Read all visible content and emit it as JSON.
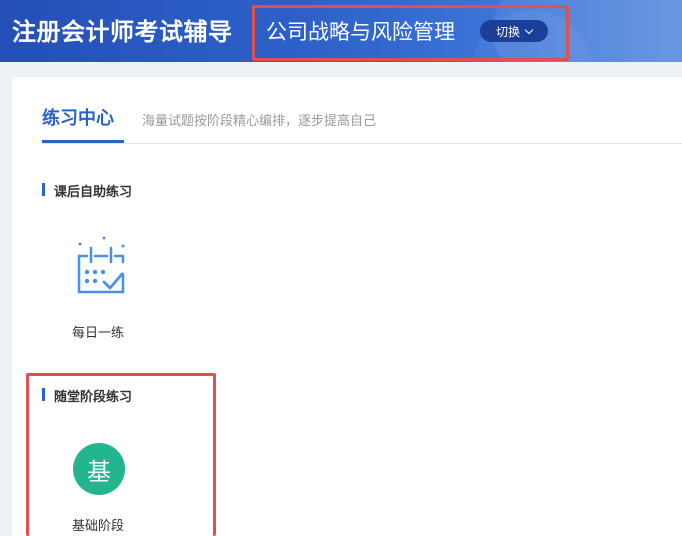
{
  "header": {
    "app_title": "注册会计师考试辅导",
    "subject": "公司战略与风险管理",
    "switch_label": "切换"
  },
  "tabs": {
    "active_label": "练习中心",
    "description": "海量试题按阶段精心编排，逐步提高自己"
  },
  "sections": [
    {
      "title": "课后自助练习",
      "items": [
        {
          "label": "每日一练",
          "icon": "calendar-check-icon"
        }
      ]
    },
    {
      "title": "随堂阶段练习",
      "items": [
        {
          "label": "基础阶段",
          "icon_text": "基",
          "icon": "stage-badge-icon"
        }
      ]
    }
  ],
  "colors": {
    "header_blue": "#2d61c9",
    "accent_blue": "#2a62cc",
    "badge_green": "#23b58d",
    "highlight_red": "#e05050"
  }
}
